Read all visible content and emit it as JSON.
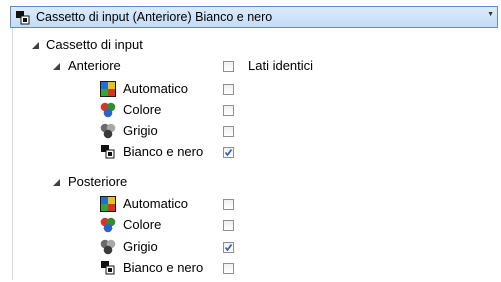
{
  "header": {
    "title": "Cassetto di input (Anteriore) Bianco e nero",
    "icon": "black-white-mode-icon"
  },
  "tree": {
    "root_label": "Cassetto di input",
    "front": {
      "label": "Anteriore",
      "same_sides_label": "Lati identici",
      "same_sides_checked": false,
      "items": [
        {
          "label": "Automatico",
          "icon": "automatic-mode-icon",
          "checked": false
        },
        {
          "label": "Colore",
          "icon": "color-mode-icon",
          "checked": false
        },
        {
          "label": "Grigio",
          "icon": "grayscale-mode-icon",
          "checked": false
        },
        {
          "label": "Bianco e nero",
          "icon": "black-white-mode-icon",
          "checked": true
        }
      ]
    },
    "back": {
      "label": "Posteriore",
      "items": [
        {
          "label": "Automatico",
          "icon": "automatic-mode-icon",
          "checked": false
        },
        {
          "label": "Colore",
          "icon": "color-mode-icon",
          "checked": false
        },
        {
          "label": "Grigio",
          "icon": "grayscale-mode-icon",
          "checked": true
        },
        {
          "label": "Bianco e nero",
          "icon": "black-white-mode-icon",
          "checked": false
        }
      ]
    }
  },
  "colors": {
    "header_border": "#5a8fc8",
    "header_bg": "#c4dcf6",
    "checkmark": "#2f5ea8"
  }
}
